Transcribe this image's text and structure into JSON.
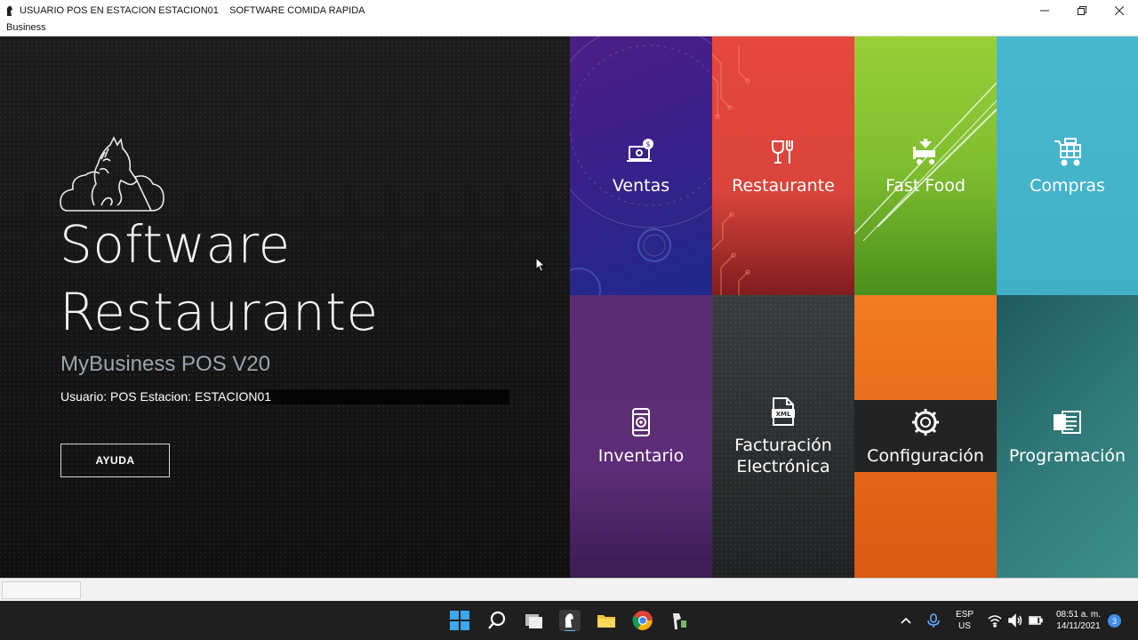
{
  "window": {
    "title": "USUARIO POS EN ESTACION ESTACION01    SOFTWARE COMIDA RAPIDA",
    "minimize_icon": "minimize-icon",
    "maximize_icon": "restore-icon",
    "close_icon": "close-icon"
  },
  "menu": {
    "items": [
      "Business"
    ]
  },
  "hero": {
    "title_line1": "Software",
    "title_line2": "Restaurante",
    "subtitle": "MyBusiness POS V20",
    "user_info": "Usuario: POS Estacion: ESTACION01",
    "help_button": "AYUDA"
  },
  "tiles": [
    {
      "label": "Ventas",
      "icon": "sales-icon",
      "color": "#3c1f8a"
    },
    {
      "label": "Restaurante",
      "icon": "wine-fork-icon",
      "color": "#e6483c"
    },
    {
      "label": "Fast Food",
      "icon": "fast-food-cart-icon",
      "color": "#80be30"
    },
    {
      "label": "Compras",
      "icon": "shopping-cart-icon",
      "color": "#41b0c6"
    },
    {
      "label": "Inventario",
      "icon": "inventory-phone-icon",
      "color": "#5e2d78"
    },
    {
      "label": "Facturación Electrónica",
      "line1": "Facturación",
      "line2": "Electrónica",
      "icon": "xml-file-icon",
      "color": "#2a2d2e"
    },
    {
      "label": "Configuración",
      "icon": "gear-icon",
      "color": "#e96a1a"
    },
    {
      "label": "Programación",
      "icon": "schedule-icon",
      "color": "#2f7a78"
    }
  ],
  "taskbar": {
    "language_line1": "ESP",
    "language_line2": "US",
    "time": "08:51 a. m.",
    "date": "14/11/2021",
    "notification_count": "3"
  }
}
